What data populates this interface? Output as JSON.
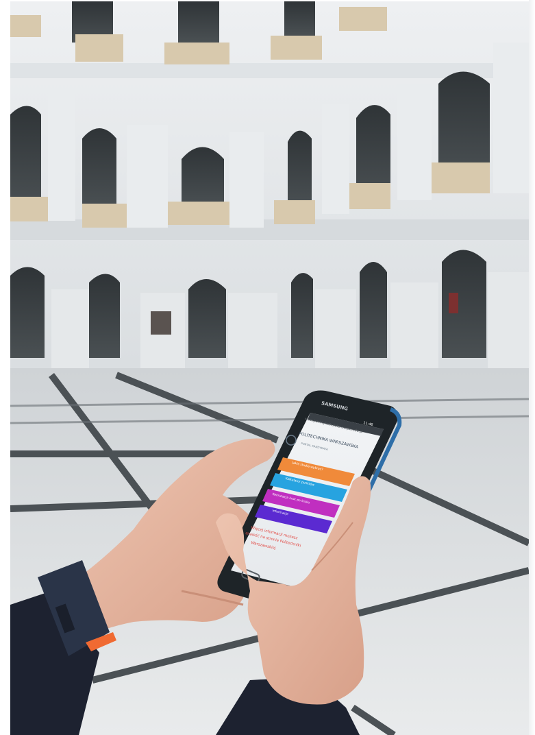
{
  "photo": {
    "subject": "hands holding smartphone in arcaded courtyard",
    "colors": {
      "wall": "#e4e7ea",
      "arch_shadow": "#3b4043",
      "balustrade": "#d8c9ad",
      "floor_light": "#dfe2e4",
      "floor_band": "#4b5155",
      "phone_body": "#1e2428",
      "phone_bezel_blue": "#2e6ea8",
      "skin": "#e7b9a3",
      "sleeve": "#1d2230",
      "watch_strap": "#2a3448",
      "watch_accent": "#f06a32"
    }
  },
  "phone": {
    "brand": "SAMSUNG",
    "status_time": "11:46",
    "url": "www.punktykalkulatorow.pw.edu.pl",
    "header_title": "POLITECHNIKA WARSZAWSKA",
    "header_subtitle": "PORTAL KANDYDATA",
    "buttons": [
      {
        "label": "Jakie studia wybrać?",
        "color": "#f08a3a"
      },
      {
        "label": "Kalkulator punktów",
        "color": "#27a3e0"
      },
      {
        "label": "Rekrutacja krok po kroku",
        "color": "#c02fc0"
      },
      {
        "label": "Informacje",
        "color": "#5b2ad1"
      }
    ],
    "footer_text_1": "Więcej informacji możesz",
    "footer_text_2": "znaleźć na stronie Politechniki",
    "footer_text_3": "Warszawskiej"
  }
}
